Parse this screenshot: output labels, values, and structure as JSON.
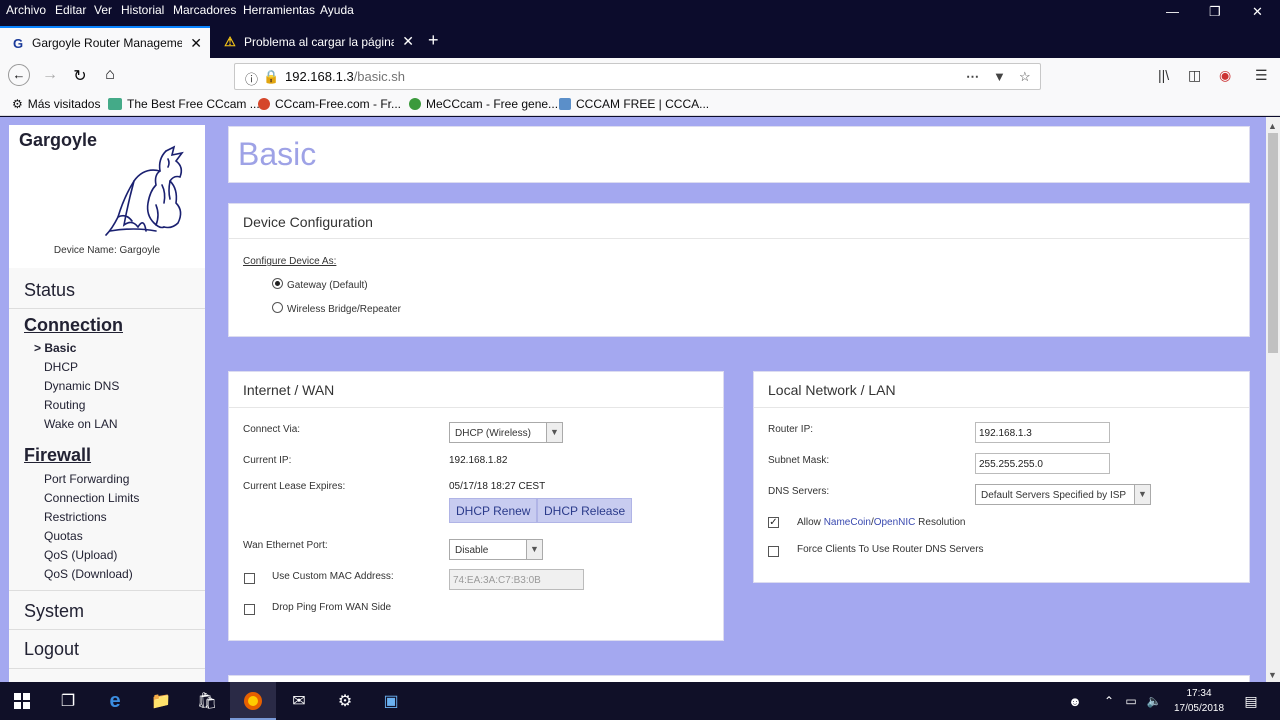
{
  "menu": [
    "Archivo",
    "Editar",
    "Ver",
    "Historial",
    "Marcadores",
    "Herramientas",
    "Ayuda"
  ],
  "tabs": [
    {
      "label": "Gargoyle Router Management",
      "icon": "G"
    },
    {
      "label": "Problema al cargar la página",
      "icon": "⚠"
    }
  ],
  "url": {
    "host": "192.168.1.3",
    "path": "/basic.sh"
  },
  "bookmarks": [
    "Más visitados",
    "The Best Free CCcam ...",
    "CCcam-Free.com - Fr...",
    "MeCCcam - Free gene...",
    "CCCAM FREE | CCCA..."
  ],
  "sidebar": {
    "brand": "Gargoyle",
    "device_name": "Device Name: Gargoyle",
    "sections": {
      "status": "Status",
      "connection": "Connection",
      "connection_items": [
        "> Basic",
        "DHCP",
        "Dynamic DNS",
        "Routing",
        "Wake on LAN"
      ],
      "firewall": "Firewall",
      "firewall_items": [
        "Port Forwarding",
        "Connection Limits",
        "Restrictions",
        "Quotas",
        "QoS (Upload)",
        "QoS (Download)"
      ],
      "system": "System",
      "logout": "Logout"
    }
  },
  "page_title": "Basic",
  "device_config": {
    "title": "Device Configuration",
    "configure_as": "Configure Device As:",
    "opt_gateway": "Gateway (Default)",
    "opt_bridge": "Wireless Bridge/Repeater"
  },
  "wan": {
    "title": "Internet / WAN",
    "connect_via_label": "Connect Via:",
    "connect_via_value": "DHCP (Wireless)",
    "current_ip_label": "Current IP:",
    "current_ip": "192.168.1.82",
    "lease_label": "Current Lease Expires:",
    "lease": "05/17/18 18:27 CEST",
    "renew": "DHCP Renew",
    "release": "DHCP Release",
    "eth_port_label": "Wan Ethernet Port:",
    "eth_port_value": "Disable",
    "custom_mac_label": "Use Custom MAC Address:",
    "custom_mac_value": "74:EA:3A:C7:B3:0B",
    "drop_ping_label": "Drop Ping From WAN Side"
  },
  "lan": {
    "title": "Local Network / LAN",
    "router_ip_label": "Router IP:",
    "router_ip": "192.168.1.3",
    "mask_label": "Subnet Mask:",
    "mask": "255.255.255.0",
    "dns_label": "DNS Servers:",
    "dns_value": "Default Servers Specified by ISP",
    "allow_prefix": "Allow ",
    "allow_namecoin": "NameCoin",
    "allow_slash": "/",
    "allow_opennic": "OpenNIC",
    "allow_suffix": " Resolution",
    "force_label": "Force Clients To Use Router DNS Servers"
  },
  "clock": {
    "time": "17:34",
    "date": "17/05/2018"
  }
}
